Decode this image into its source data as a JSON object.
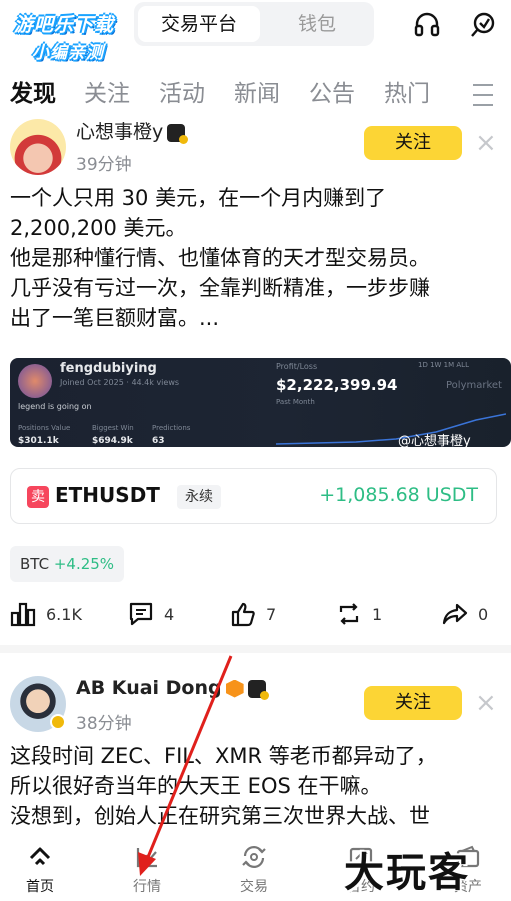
{
  "watermark": {
    "line1": "游吧乐下载",
    "line2": "小编亲测"
  },
  "header": {
    "tabs": [
      {
        "label": "交易平台",
        "active": true
      },
      {
        "label": "钱包",
        "active": false
      }
    ],
    "icons": [
      "headset-icon",
      "support-icon"
    ]
  },
  "categories": [
    "发现",
    "关注",
    "活动",
    "新闻",
    "公告",
    "热门"
  ],
  "posts": [
    {
      "author": "心想事橙y",
      "time": "39分钟",
      "follow_label": "关注",
      "lines": [
        "一个人只用 30 美元，在一个月内赚到了",
        "2,200,200 美元。",
        "他是那种懂行情、也懂体育的天才型交易员。",
        "几乎没有亏过一次，全靠判断精准，一步步赚",
        "出了一笔巨额财富。..."
      ],
      "embed": {
        "name": "fengdubiying",
        "sub": "Joined Oct 2025 · 44.4k views",
        "bio": "legend is going on",
        "stats": [
          {
            "label": "Positions Value",
            "value": "$301.1k"
          },
          {
            "label": "Biggest Win",
            "value": "$694.9k"
          },
          {
            "label": "Predictions",
            "value": "63"
          }
        ],
        "pl_label": "Profit/Loss",
        "pl_value": "$2,222,399.94",
        "period": "Past Month",
        "ranges": "1D   1W   1M   ALL",
        "platform": "Polymarket",
        "handle": "@心想事橙y"
      },
      "trade": {
        "side": "卖",
        "pair": "ETHUSDT",
        "type": "永续",
        "pnl": "+1,085.68 USDT"
      },
      "chip": {
        "symbol": "BTC",
        "change": "+4.25%"
      },
      "actions": {
        "views": "6.1K",
        "comments": "4",
        "likes": "7",
        "reposts": "1",
        "shares": "0"
      }
    },
    {
      "author": "AB Kuai Dong",
      "time": "38分钟",
      "follow_label": "关注",
      "lines": [
        "这段时间 ZEC、FIL、XMR 等老币都异动了，",
        "所以很好奇当年的大天王 EOS 在干嘛。",
        "没想到，创始人正在研究第三次世界大战、世"
      ]
    }
  ],
  "bottom_nav": [
    {
      "label": "首页",
      "icon": "home-icon",
      "active": true
    },
    {
      "label": "行情",
      "icon": "markets-icon",
      "active": false
    },
    {
      "label": "交易",
      "icon": "trade-icon",
      "active": false
    },
    {
      "label": "合约",
      "icon": "futures-icon",
      "active": false
    },
    {
      "label": "资产",
      "icon": "assets-icon",
      "active": false
    }
  ],
  "bottom_watermark": "大玩客",
  "colors": {
    "accent": "#fcd535",
    "up": "#2ebd85",
    "sell": "#f6465d",
    "arrow": "#e0201c"
  }
}
